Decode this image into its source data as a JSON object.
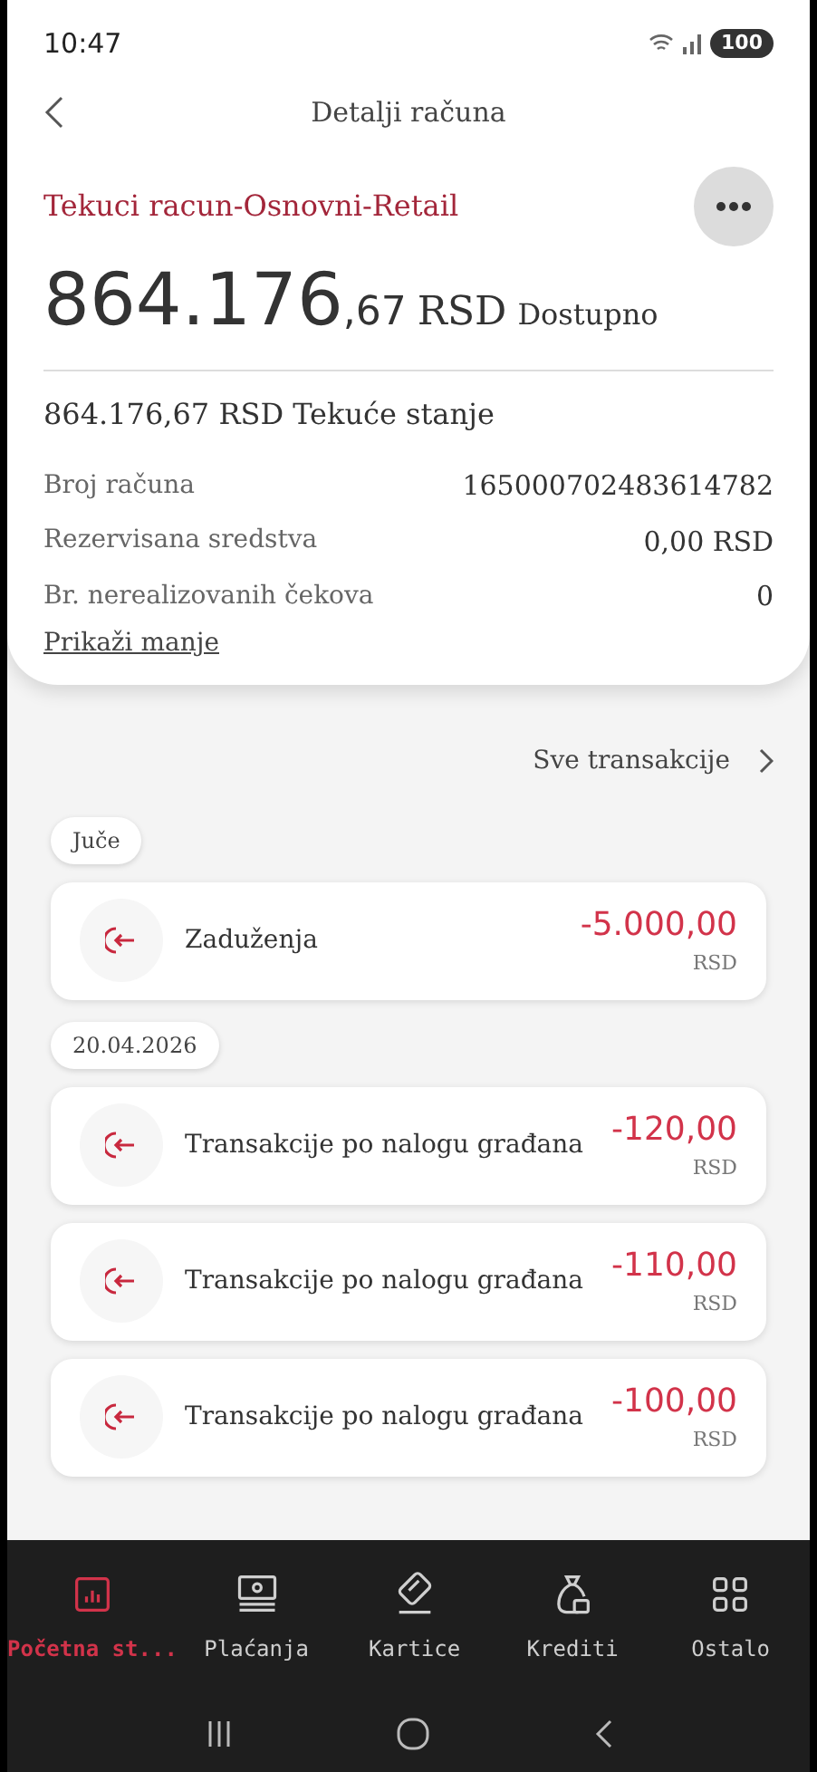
{
  "status_bar": {
    "time": "10:47",
    "battery": "100"
  },
  "header": {
    "title": "Detalji računa"
  },
  "account": {
    "name": "Tekuci racun-Osnovni-Retail",
    "balance_whole": "864.176",
    "balance_decimals": ",67",
    "balance_currency": "RSD",
    "balance_label": "Dostupno",
    "current_balance": "864.176,67 RSD Tekuće stanje",
    "details": [
      {
        "label": "Broj računa",
        "value": "165000702483614782"
      },
      {
        "label": "Rezervisana sredstva",
        "value": "0,00 RSD"
      },
      {
        "label": "Br. nerealizovanih čekova",
        "value": "0"
      }
    ],
    "toggle_link": "Prikaži manje"
  },
  "all_transactions_link": "Sve transakcije",
  "transaction_groups": [
    {
      "date": "Juče",
      "transactions": [
        {
          "description": "Zaduženja",
          "amount": "-5.000,00",
          "currency": "RSD"
        }
      ]
    },
    {
      "date": "20.04.2026",
      "transactions": [
        {
          "description": "Transakcije po nalogu građana",
          "amount": "-120,00",
          "currency": "RSD"
        },
        {
          "description": "Transakcije po nalogu građana",
          "amount": "-110,00",
          "currency": "RSD"
        },
        {
          "description": "Transakcije po nalogu građana",
          "amount": "-100,00",
          "currency": "RSD"
        }
      ]
    }
  ],
  "bottom_nav": [
    {
      "kind": "home",
      "label": "Početna st...",
      "selected": true
    },
    {
      "kind": "payments",
      "label": "Plaćanja",
      "selected": false
    },
    {
      "kind": "cards",
      "label": "Kartice",
      "selected": false
    },
    {
      "kind": "loans",
      "label": "Krediti",
      "selected": false
    },
    {
      "kind": "more",
      "label": "Ostalo",
      "selected": false
    }
  ]
}
